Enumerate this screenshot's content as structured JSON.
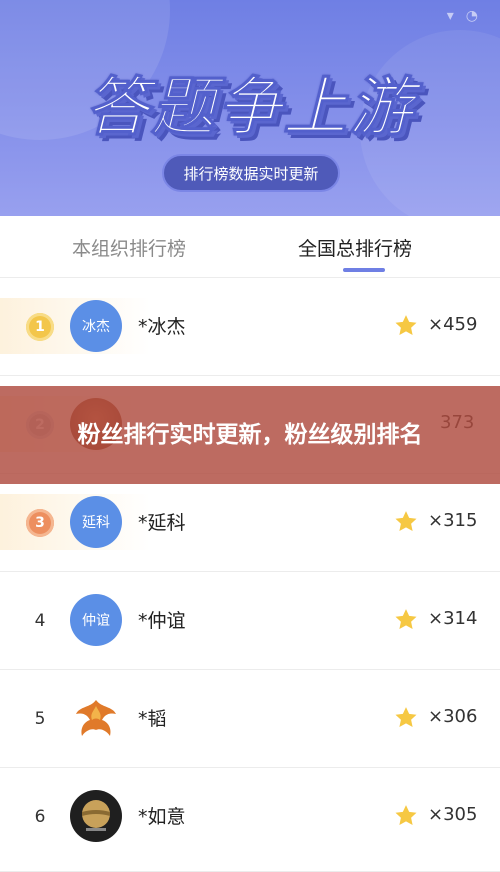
{
  "header": {
    "title": "答题争上游",
    "subtitle": "排行榜数据实时更新"
  },
  "tabs": [
    {
      "label": "本组织排行榜",
      "active": false
    },
    {
      "label": "全国总排行榜",
      "active": true
    }
  ],
  "ranking": [
    {
      "rank": "1",
      "avatar": "冰杰",
      "name": "*冰杰",
      "score": "×459"
    },
    {
      "rank": "2",
      "avatar": "",
      "name": "",
      "score": "373"
    },
    {
      "rank": "3",
      "avatar": "延科",
      "name": "*延科",
      "score": "×315"
    },
    {
      "rank": "4",
      "avatar": "仲谊",
      "name": "*仲谊",
      "score": "×314"
    },
    {
      "rank": "5",
      "avatar": "",
      "name": "*韬",
      "score": "×306"
    },
    {
      "rank": "6",
      "avatar": "",
      "name": "*如意",
      "score": "×305"
    }
  ],
  "overlay": {
    "text": "粉丝排行实时更新，粉丝级别排名"
  },
  "colors": {
    "header_bg": "#7e8ae8",
    "accent": "#6f7fe4",
    "avatar_blue": "#5b8fe6",
    "star": "#f6c843",
    "overlay": "#b04c3f"
  },
  "icons": [
    "star-icon",
    "phoenix-avatar",
    "dark-avatar"
  ]
}
